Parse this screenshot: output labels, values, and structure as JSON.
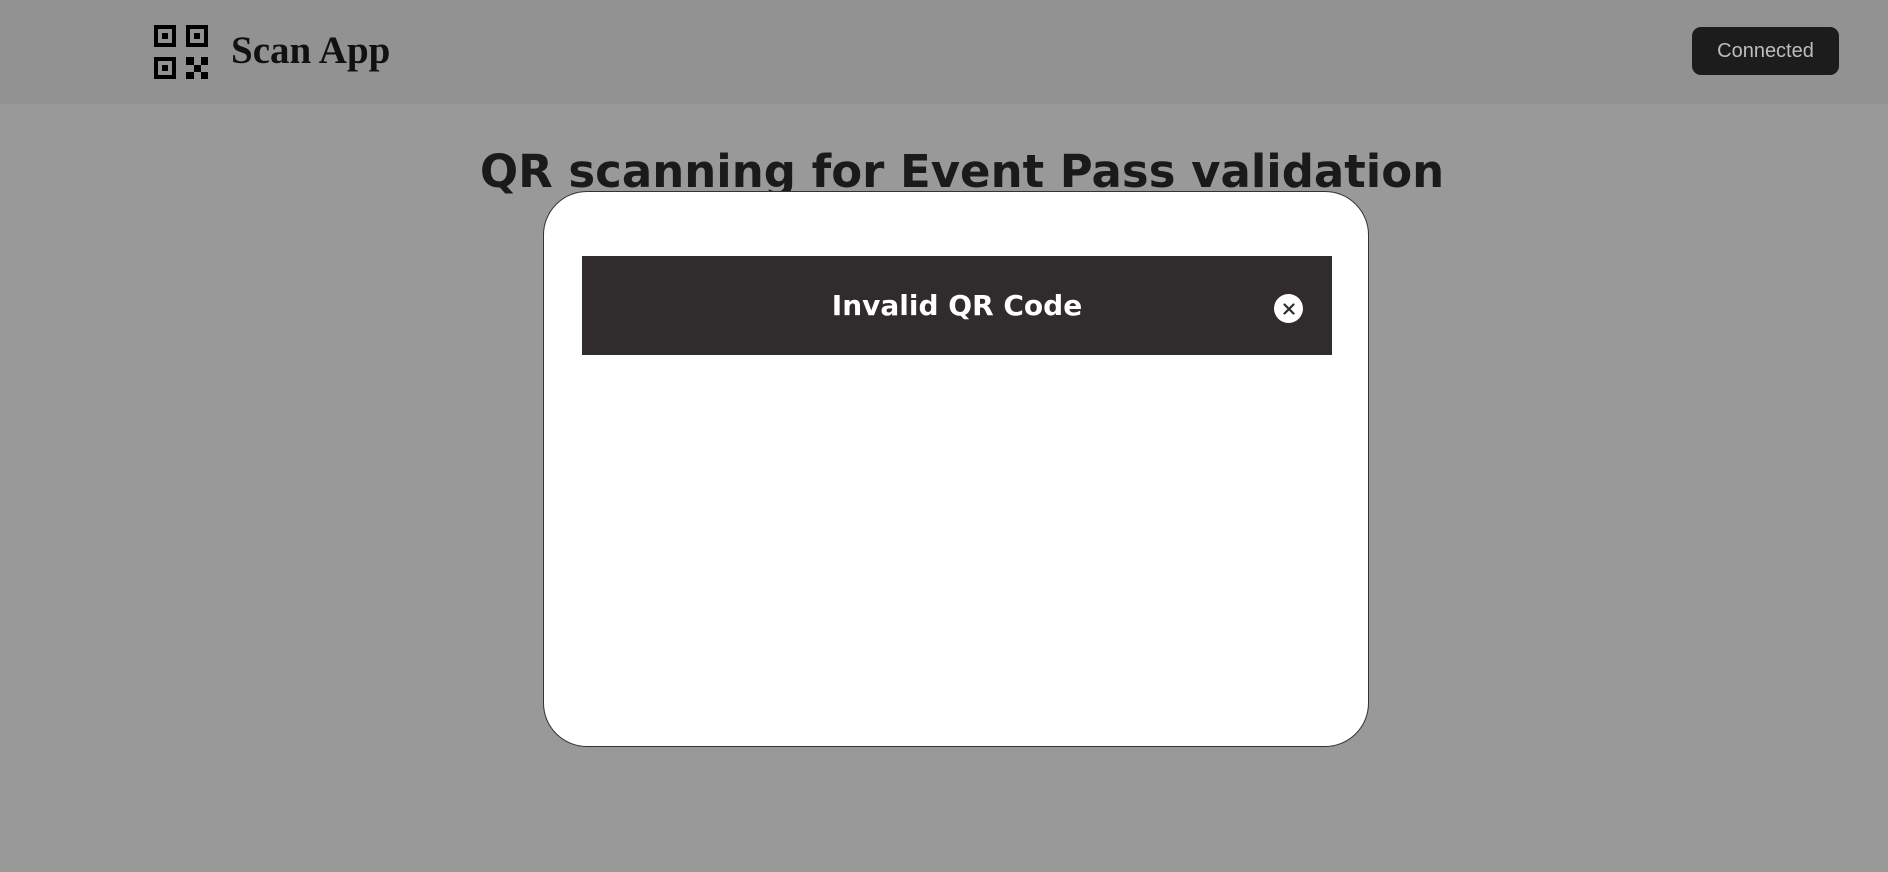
{
  "header": {
    "app_name": "Scan App",
    "logo_icon": "qr-code-icon",
    "status_button_label": "Connected"
  },
  "main": {
    "title": "QR scanning for Event Pass validation"
  },
  "modal": {
    "title": "Invalid QR Code",
    "close_icon": "close-icon"
  },
  "colors": {
    "overlay_background": "#999999",
    "header_background": "#929292",
    "status_button_background": "#1c1c1c",
    "modal_header_background": "#302c2d",
    "modal_background": "#ffffff"
  }
}
